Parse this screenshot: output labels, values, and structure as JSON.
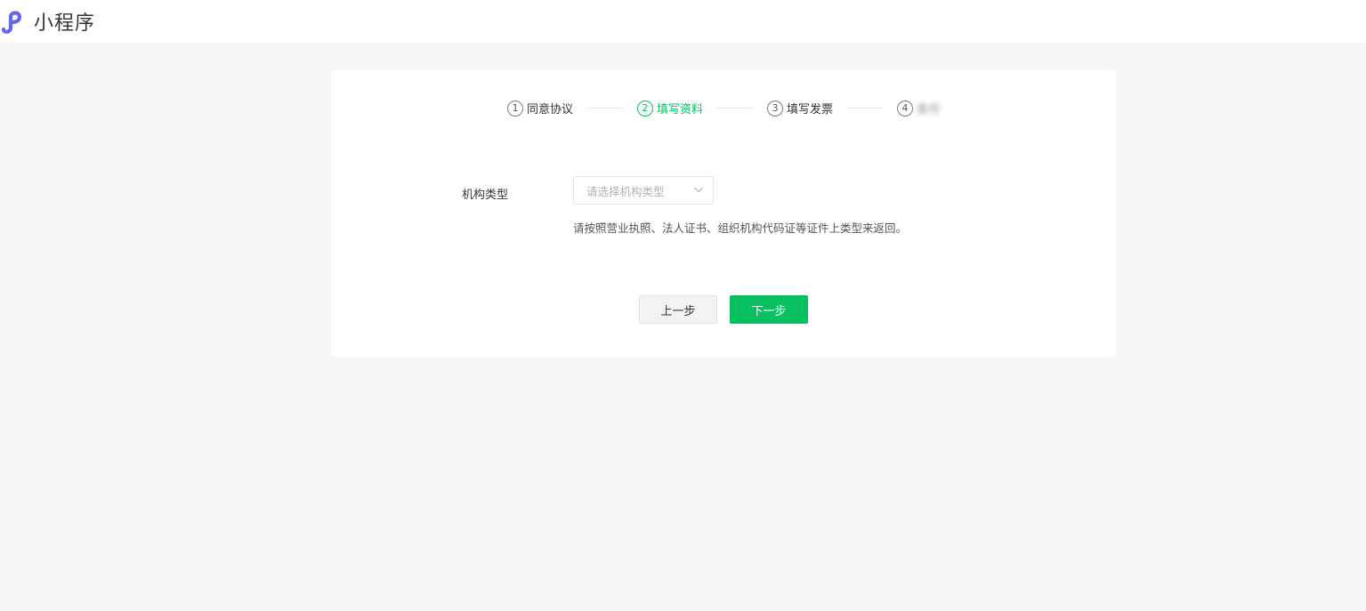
{
  "header": {
    "title": "小程序",
    "logo_icon": "mini-program-logo-icon",
    "logo_color": "#6467f0"
  },
  "steps": [
    {
      "number": "1",
      "label": "同意协议"
    },
    {
      "number": "2",
      "label": "填写资料"
    },
    {
      "number": "3",
      "label": "填写发票"
    },
    {
      "number": "4",
      "label": "支付"
    }
  ],
  "form": {
    "org_type_label": "机构类型",
    "org_type_placeholder": "请选择机构类型",
    "org_type_hint": "请按照营业执照、法人证书、组织机构代码证等证件上类型来返回。"
  },
  "actions": {
    "prev_label": "上一步",
    "next_label": "下一步"
  },
  "colors": {
    "accent": "#07c160",
    "background": "#f6f7f7"
  }
}
